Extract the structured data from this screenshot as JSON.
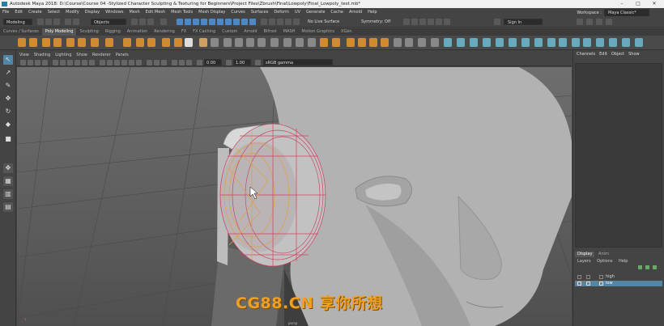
{
  "titlebar": {
    "title": "Autodesk Maya 2018: D:\\Course\\Course 04 -Stylized Character Sculpting & Texturing for Beginners\\Project Files\\Zbrush\\Final\\Lowpoly\\Final_Lowpoly_test.mb*"
  },
  "menubar": {
    "items": [
      "File",
      "Edit",
      "Create",
      "Select",
      "Modify",
      "Display",
      "Windows",
      "Mesh",
      "Edit Mesh",
      "Mesh Tools",
      "Mesh Display",
      "Curves",
      "Surfaces",
      "Deform",
      "UV",
      "Generate",
      "Cache",
      "Arnold",
      "Help"
    ],
    "workspace_label": "Workspace :",
    "workspace_value": "Maya Classic*"
  },
  "statusline": {
    "mode": "Modeling",
    "objects": "Objects",
    "live_surface": "No Live Surface",
    "symmetry": "Symmetry: Off",
    "sign_in": "Sign In"
  },
  "shelf_tabs": [
    "Curves / Surfaces",
    "Poly Modeling",
    "Sculpting",
    "Rigging",
    "Animation",
    "Rendering",
    "FX",
    "FX Caching",
    "Custom",
    "Arnold",
    "Bifrost",
    "MASH",
    "Motion Graphics",
    "XGen"
  ],
  "viewport": {
    "menu": [
      "View",
      "Shading",
      "Lighting",
      "Show",
      "Renderer",
      "Panels"
    ],
    "field_a": "0.00",
    "field_b": "1.00",
    "color_space": "sRGB gamma",
    "camera_label": "persp"
  },
  "channelbox": {
    "header": [
      "Channels",
      "Edit",
      "Object",
      "Show"
    ]
  },
  "layers": {
    "tabs": [
      "Display",
      "Anim"
    ],
    "menu": [
      "Layers",
      "Options",
      "Help"
    ],
    "rows": [
      {
        "name": "high",
        "selected": false
      },
      {
        "name": "low",
        "selected": true
      }
    ]
  },
  "watermark": "CG88.CN 享你所想"
}
